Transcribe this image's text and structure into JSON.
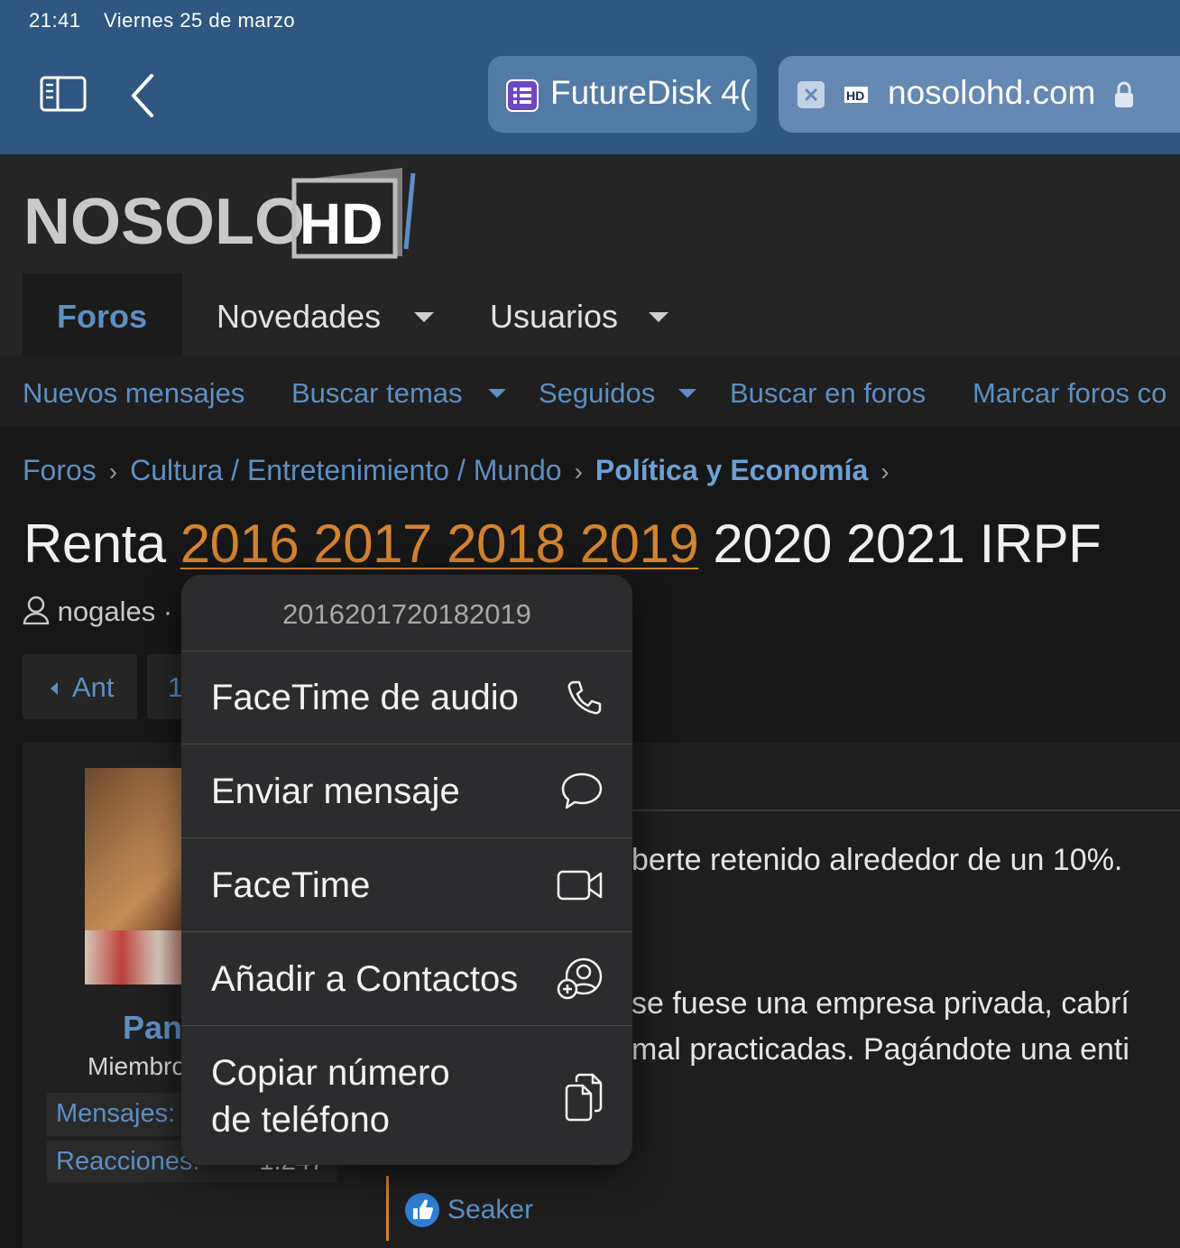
{
  "status": {
    "time": "21:41",
    "date": "Viernes 25 de marzo"
  },
  "tabs": [
    {
      "title": "FutureDisk 4("
    },
    {
      "title": "nosolohd.com"
    }
  ],
  "logo": {
    "part1": "NOSOLO",
    "part2": "HD"
  },
  "nav": {
    "foros": "Foros",
    "novedades": "Novedades",
    "usuarios": "Usuarios"
  },
  "subnav": [
    "Nuevos mensajes",
    "Buscar temas",
    "Seguidos",
    "Buscar en foros",
    "Marcar foros co"
  ],
  "breadcrumb": [
    "Foros",
    "Cultura / Entretenimiento / Mundo",
    "Política y Economía"
  ],
  "thread": {
    "title_start": "Renta ",
    "title_years": "2016 2017 2018 2019",
    "title_end": " 2020 2021 IRPF",
    "author": "nogales",
    "author_sep": "·"
  },
  "pagination": {
    "prev": "Ant",
    "page1": "1"
  },
  "post": {
    "user": "Pan",
    "role": "Miembro",
    "stats": [
      {
        "label": "Mensajes:",
        "value": ""
      },
      {
        "label": "Reacciones:",
        "value": "1.247"
      }
    ],
    "lines": [
      "berte retenido alrededor de un 10%.",
      "se fuese una empresa privada, cabrí",
      "mal practicadas. Pagándote una enti"
    ],
    "reaction_user": "Seaker"
  },
  "context_menu": {
    "header": "2016201720182019",
    "items": [
      {
        "label": "FaceTime de audio",
        "icon": "phone-icon"
      },
      {
        "label": "Enviar mensaje",
        "icon": "message-bubble-icon"
      },
      {
        "label": "FaceTime",
        "icon": "video-camera-icon"
      },
      {
        "label": "Añadir a Contactos",
        "icon": "add-contact-icon"
      },
      {
        "label": "Copiar número\nde teléfono",
        "icon": "copy-icon"
      }
    ]
  },
  "colors": {
    "tab_bar": "#2f5781",
    "accent": "#5d8fc4",
    "highlight": "#d3842f",
    "menu_bg": "#2c2c2e"
  }
}
